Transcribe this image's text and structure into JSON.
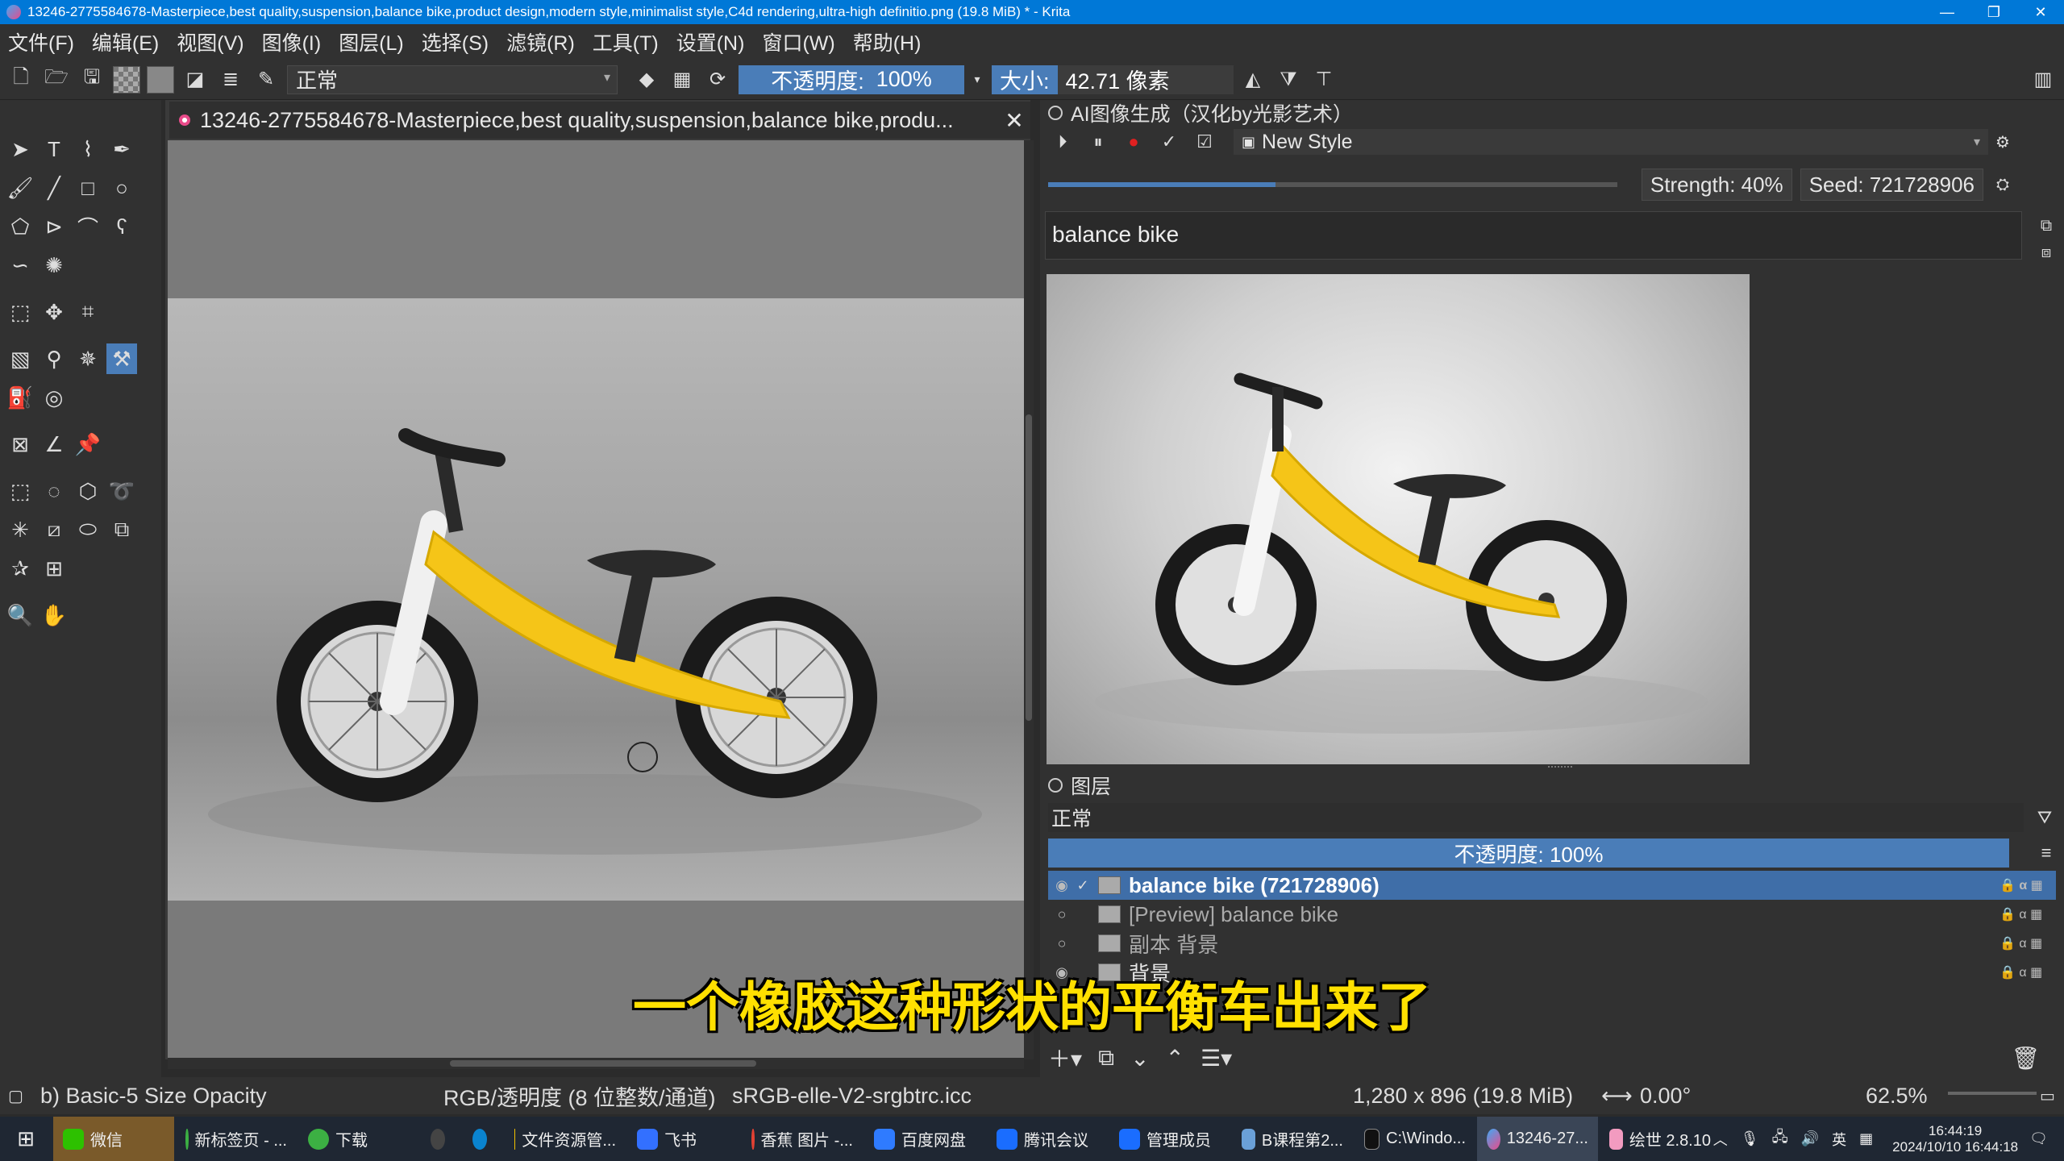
{
  "window": {
    "title": "13246-2775584678-Masterpiece,best quality,suspension,balance bike,product design,modern style,minimalist style,C4d rendering,ultra-high definitio.png (19.8 MiB) * - Krita",
    "minimize": "—",
    "restore": "❐",
    "close": "✕"
  },
  "menu": [
    "文件(F)",
    "编辑(E)",
    "视图(V)",
    "图像(I)",
    "图层(L)",
    "选择(S)",
    "滤镜(R)",
    "工具(T)",
    "设置(N)",
    "窗口(W)",
    "帮助(H)"
  ],
  "toolbar": {
    "blend_mode": "正常",
    "opacity_label": "不透明度:",
    "opacity_value": "100%",
    "size_label": "大小:",
    "size_value": "42.71 像素"
  },
  "document": {
    "tab_title": "13246-2775584678-Masterpiece,best quality,suspension,balance bike,produ...",
    "close": "✕"
  },
  "ai_panel": {
    "title": "AI图像生成（汉化by光影艺术）",
    "style": "New Style",
    "strength": "Strength: 40%",
    "strength_fraction": 0.4,
    "seed": "Seed: 721728906",
    "prompt": "balance bike"
  },
  "layers_panel": {
    "title": "图层",
    "blend_mode": "正常",
    "opacity": "不透明度:  100%",
    "layers": [
      {
        "name": "balance bike  (721728906)",
        "selected": true
      },
      {
        "name": "[Preview] balance bike",
        "selected": false
      },
      {
        "name": "副本 背景",
        "selected": false
      },
      {
        "name": "背景",
        "selected": false
      }
    ]
  },
  "subtitle": "一个橡胶这种形状的平衡车出来了",
  "status": {
    "brush": "b) Basic-5 Size Opacity",
    "color_model": "RGB/透明度 (8 位整数/通道)",
    "profile": "sRGB-elle-V2-srgbtrc.icc",
    "dimensions": "1,280 x 896 (19.8 MiB)",
    "rotation": "0.00°",
    "zoom": "62.5%"
  },
  "taskbar": {
    "items": [
      "微信",
      "新标签页 - ...",
      "下载",
      "文件资源管...",
      "飞书",
      "香蕉 图片 -...",
      "百度网盘",
      "腾讯会议",
      "管理成员",
      "B课程第2...",
      "C:\\Windo...",
      "13246-27...",
      "绘世 2.8.10"
    ],
    "ime": "英",
    "time": "16:44:19",
    "date": "2024/10/10 16:44:18"
  },
  "colors": {
    "accent": "#4a7db8",
    "titlebar": "#0078d7",
    "subtitle": "#ffe000",
    "bike_yellow": "#f5c518"
  }
}
